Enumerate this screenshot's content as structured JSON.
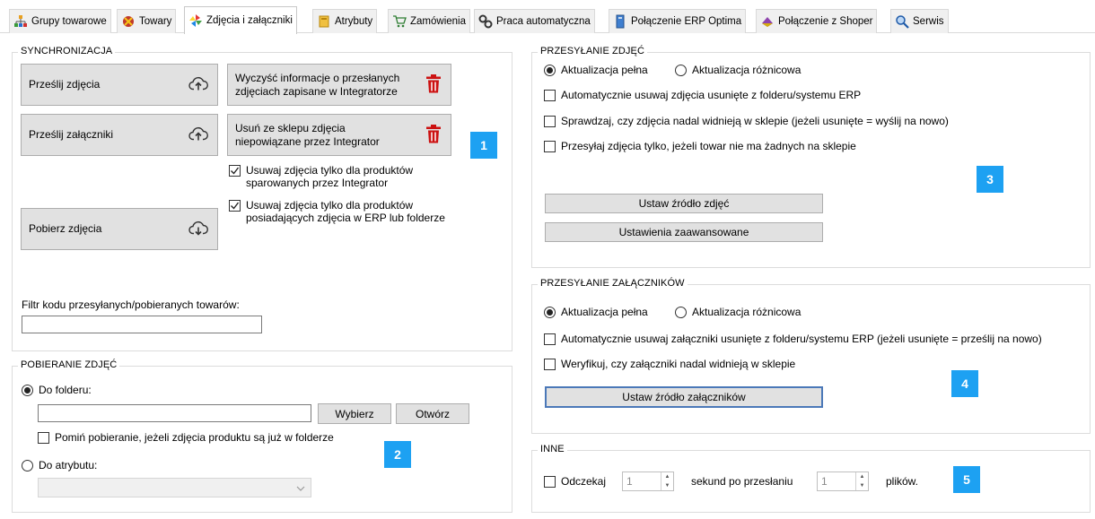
{
  "tabs": [
    {
      "label": "Grupy towarowe",
      "icon": "hierarchy-icon"
    },
    {
      "label": "Towary",
      "icon": "product-icon"
    },
    {
      "label": "Zdjęcia i załączniki",
      "icon": "pinwheel-icon"
    },
    {
      "label": "Atrybuty",
      "icon": "attribute-icon"
    },
    {
      "label": "Zamówienia",
      "icon": "cart-icon"
    },
    {
      "label": "Praca automatyczna",
      "icon": "gears-icon"
    },
    {
      "label": "Połączenie ERP Optima",
      "icon": "erp-icon"
    },
    {
      "label": "Połączenie z Shoper",
      "icon": "shoper-icon"
    },
    {
      "label": "Serwis",
      "icon": "magnifier-icon"
    }
  ],
  "sync": {
    "title": "SYNCHRONIZACJA",
    "send_photos": "Prześlij zdjęcia",
    "send_attachments": "Prześlij załączniki",
    "download_photos": "Pobierz zdjęcia",
    "clear_info_line1": "Wyczyść informacje o przesłanych",
    "clear_info_line2": "zdjęciach zapisane w Integratorze",
    "remove_line1": "Usuń ze sklepu zdjęcia",
    "remove_line2": "niepowiązane przez Integrator",
    "chk1_line1": "Usuwaj zdjęcia tylko dla produktów",
    "chk1_line2": "sparowanych przez Integrator",
    "chk2_line1": "Usuwaj zdjęcia tylko dla produktów",
    "chk2_line2": "posiadających zdjęcia w ERP lub folderze",
    "filter_label": "Filtr kodu przesyłanych/pobieranych towarów:",
    "filter_value": "",
    "badge": "1"
  },
  "download": {
    "title": "POBIERANIE ZDJĘĆ",
    "to_folder": "Do folderu:",
    "folder_value": "",
    "choose": "Wybierz",
    "open": "Otwórz",
    "skip": "Pomiń pobieranie, jeżeli zdjęcia produktu są już w folderze",
    "to_attribute": "Do atrybutu:",
    "attribute_value": "",
    "badge": "2"
  },
  "photo_upload": {
    "title": "PRZESYŁANIE ZDJĘĆ",
    "full": "Aktualizacja pełna",
    "diff": "Aktualizacja różnicowa",
    "chk_auto": "Automatycznie usuwaj zdjęcia usunięte z folderu/systemu ERP",
    "chk_check": "Sprawdzaj, czy zdjęcia nadal widnieją w sklepie (jeżeli usunięte = wyślij na nowo)",
    "chk_only": "Przesyłaj zdjęcia tylko, jeżeli towar nie ma żadnych na sklepie",
    "set_source": "Ustaw źródło zdjęć",
    "advanced": "Ustawienia zaawansowane",
    "badge": "3"
  },
  "attach_upload": {
    "title": "PRZESYŁANIE ZAŁĄCZNIKÓW",
    "full": "Aktualizacja pełna",
    "diff": "Aktualizacja różnicowa",
    "chk_auto": "Automatycznie usuwaj załączniki usunięte z folderu/systemu ERP (jeżeli usunięte = prześlij na nowo)",
    "chk_verify": "Weryfikuj, czy załączniki nadal widnieją w sklepie",
    "set_source": "Ustaw źródło załączników",
    "badge": "4"
  },
  "other": {
    "title": "INNE",
    "wait": "Odczekaj",
    "wait_value": "1",
    "seconds_after": "sekund po przesłaniu",
    "files_value": "1",
    "files": "plików.",
    "badge": "5"
  },
  "colors": {
    "badge": "#1da1f2",
    "trash": "#cc1111",
    "button_bg": "#e1e1e1"
  }
}
